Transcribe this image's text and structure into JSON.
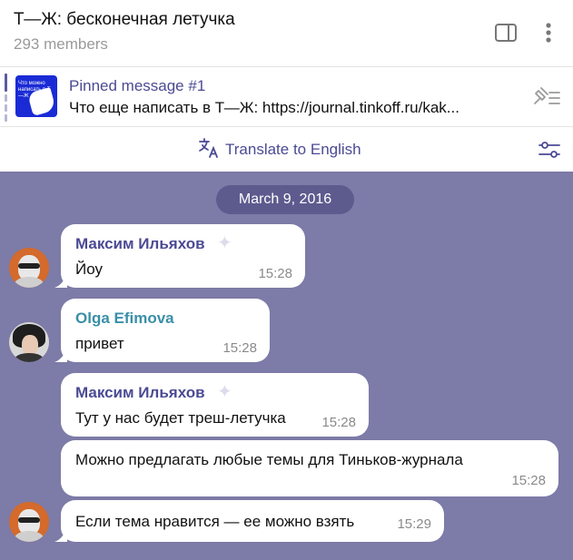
{
  "header": {
    "title": "Т—Ж: бесконечная летучка",
    "members": "293 members",
    "icons": [
      "sidebar-toggle-icon",
      "more-vertical-icon"
    ]
  },
  "pinned": {
    "title": "Pinned message #1",
    "text": "Что еще написать в Т—Ж: https://journal.tinkoff.ru/kak...",
    "thumb_text": "Что можно написать в Т—Ж",
    "icons": [
      "pinned-list-icon"
    ]
  },
  "translate": {
    "label": "Translate to English",
    "icons": [
      "translate-icon",
      "translate-settings-icon"
    ]
  },
  "chat": {
    "date": "March 9, 2016",
    "messages": [
      {
        "sender": "Максим Ильяхов",
        "text": "Йоу",
        "time": "15:28"
      },
      {
        "sender": "Olga Efimova",
        "text": "привет",
        "time": "15:28"
      },
      {
        "sender": "Максим Ильяхов",
        "text": "Тут у нас будет треш-летучка",
        "time": "15:28"
      },
      {
        "sender": "",
        "text": "Можно предлагать любые темы для Тиньков-журнала",
        "time": "15:28"
      },
      {
        "sender": "",
        "text": "Если тема нравится — ее можно взять",
        "time": "15:29"
      }
    ]
  },
  "colors": {
    "accent": "#4b4a94",
    "chat_background": "#7d7ba7",
    "date_pill": "#5d5b8e",
    "sender_olga": "#3a8fa7"
  }
}
